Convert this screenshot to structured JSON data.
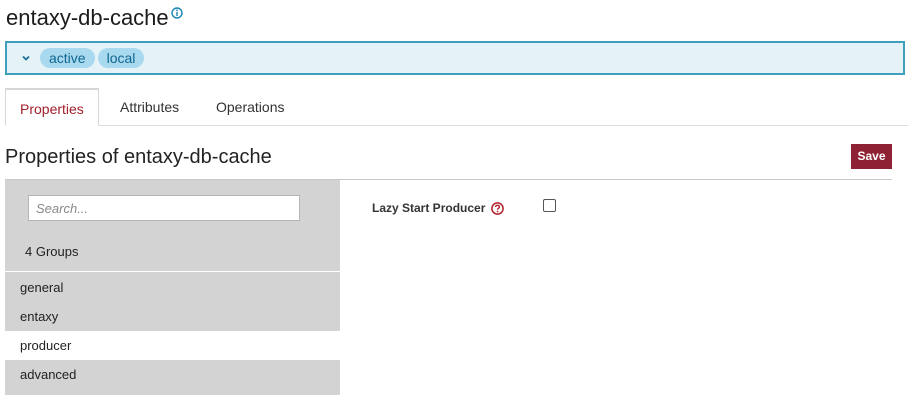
{
  "header": {
    "title": "entaxy-db-cache"
  },
  "status": {
    "badges": [
      "active",
      "local"
    ]
  },
  "tabs": [
    {
      "label": "Properties",
      "active": true
    },
    {
      "label": "Attributes",
      "active": false
    },
    {
      "label": "Operations",
      "active": false
    }
  ],
  "properties": {
    "title": "Properties of entaxy-db-cache",
    "save_label": "Save",
    "search_placeholder": "Search...",
    "groups_count": "4 Groups",
    "groups": [
      {
        "label": "general",
        "selected": false
      },
      {
        "label": "entaxy",
        "selected": false
      },
      {
        "label": "producer",
        "selected": true
      },
      {
        "label": "advanced",
        "selected": false
      }
    ],
    "fields": [
      {
        "label": "Lazy Start Producer",
        "checked": false
      }
    ]
  },
  "colors": {
    "accent": "#a3202c",
    "save_button": "#8e2234",
    "status_border": "#3f9fbd",
    "status_bg": "#e5f3f9",
    "badge_bg": "#a8d9ee",
    "panel_bg": "#d3d3d3"
  },
  "icons": {
    "title_info": "info-circle-icon",
    "status_toggle": "chevron-down-icon",
    "field_help": "question-circle-icon"
  }
}
